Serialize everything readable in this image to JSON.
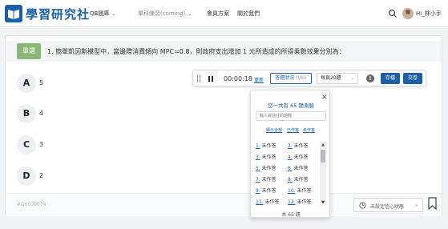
{
  "brand": {
    "logo_text": "學習研究社",
    "logo_icon": "book-logo-icon",
    "accent": "#1a5fa8"
  },
  "nav": {
    "items": [
      {
        "label": "QB題庫",
        "dropdown": true
      },
      {
        "label": "單科練習(coming)",
        "dropdown": true
      },
      {
        "label": "會員方案",
        "dropdown": false
      },
      {
        "label": "關於我們",
        "dropdown": false
      }
    ],
    "user_name": "Hi_林小手"
  },
  "question": {
    "tag": "單選",
    "text": "1. 簡單凱因斯模型中，當邊際消費傾向 MPC=0.8，則政府支出增加 1 元所造成的所得乘數效果分別為：",
    "options": [
      {
        "letter": "A",
        "value": "5"
      },
      {
        "letter": "B",
        "value": "4"
      },
      {
        "letter": "C",
        "value": "3"
      },
      {
        "letter": "D",
        "value": "2"
      }
    ],
    "id": "#Q0039074"
  },
  "toolbar": {
    "timer": "00:00:18",
    "reset": "重新",
    "status_label": "答題狀況",
    "status_count": "0/65",
    "per_page": "每頁20題",
    "save": "存檔",
    "submit": "交卷"
  },
  "panel": {
    "title": "您一共有 65 題測驗",
    "search_placeholder": "輸入欲前往的題數",
    "filters": [
      "顯示全部",
      "已作答",
      "未作答"
    ],
    "items": [
      {
        "num": "1.",
        "state": "未作答"
      },
      {
        "num": "2.",
        "state": "未作答"
      },
      {
        "num": "3.",
        "state": "未作答"
      },
      {
        "num": "4.",
        "state": "未作答"
      },
      {
        "num": "5.",
        "state": "未作答"
      },
      {
        "num": "6.",
        "state": "未作答"
      },
      {
        "num": "7.",
        "state": "未作答"
      },
      {
        "num": "8.",
        "state": "未作答"
      },
      {
        "num": "9.",
        "state": "未作答"
      },
      {
        "num": "10.",
        "state": "未作答"
      },
      {
        "num": "11.",
        "state": "未作答"
      },
      {
        "num": "12.",
        "state": "未作答"
      }
    ],
    "total": "共 65 題"
  },
  "footer": {
    "confidence": "未設定信心狀態"
  }
}
